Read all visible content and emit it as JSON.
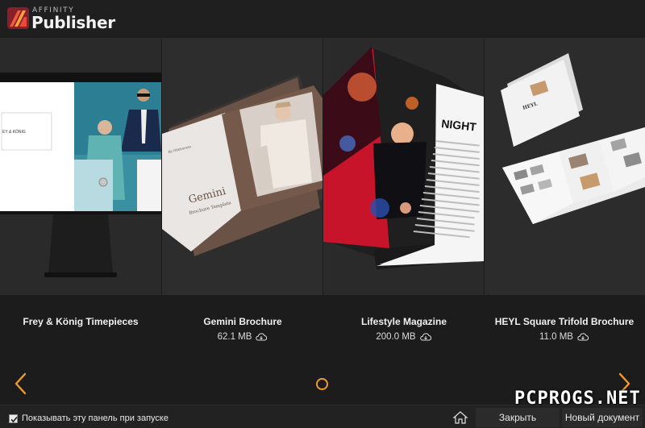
{
  "app": {
    "brand_small": "AFFINITY",
    "brand_big": "Publisher"
  },
  "templates": [
    {
      "title": "Frey & König Timepieces",
      "size": ""
    },
    {
      "title": "Gemini Brochure",
      "size": "62.1 MB"
    },
    {
      "title": "Lifestyle Magazine",
      "size": "200.0 MB"
    },
    {
      "title": "HEYL Square Trifold Brochure",
      "size": "11.0 MB"
    }
  ],
  "thumbs": {
    "frey_label": "EY & KÖNIG",
    "gemini_title": "Gemini",
    "gemini_sub": "Brochure Template",
    "gemini_by": "By Ohhhorwin",
    "night_title": "NIGHT",
    "heyl_logo": "HEYL"
  },
  "footer": {
    "show_on_start_label": "Показывать эту панель при запуске",
    "show_on_start_checked": true,
    "close_label": "Закрыть",
    "new_document_label": "Новый документ"
  },
  "watermark": "PCPROGS.NET",
  "colors": {
    "accent": "#f39a2b",
    "background": "#1b1b1b"
  },
  "icons": {
    "logo": "affinity-logo-icon",
    "cloud": "cloud-download-icon",
    "prev": "chevron-left-icon",
    "next": "chevron-right-icon",
    "home": "home-icon"
  }
}
